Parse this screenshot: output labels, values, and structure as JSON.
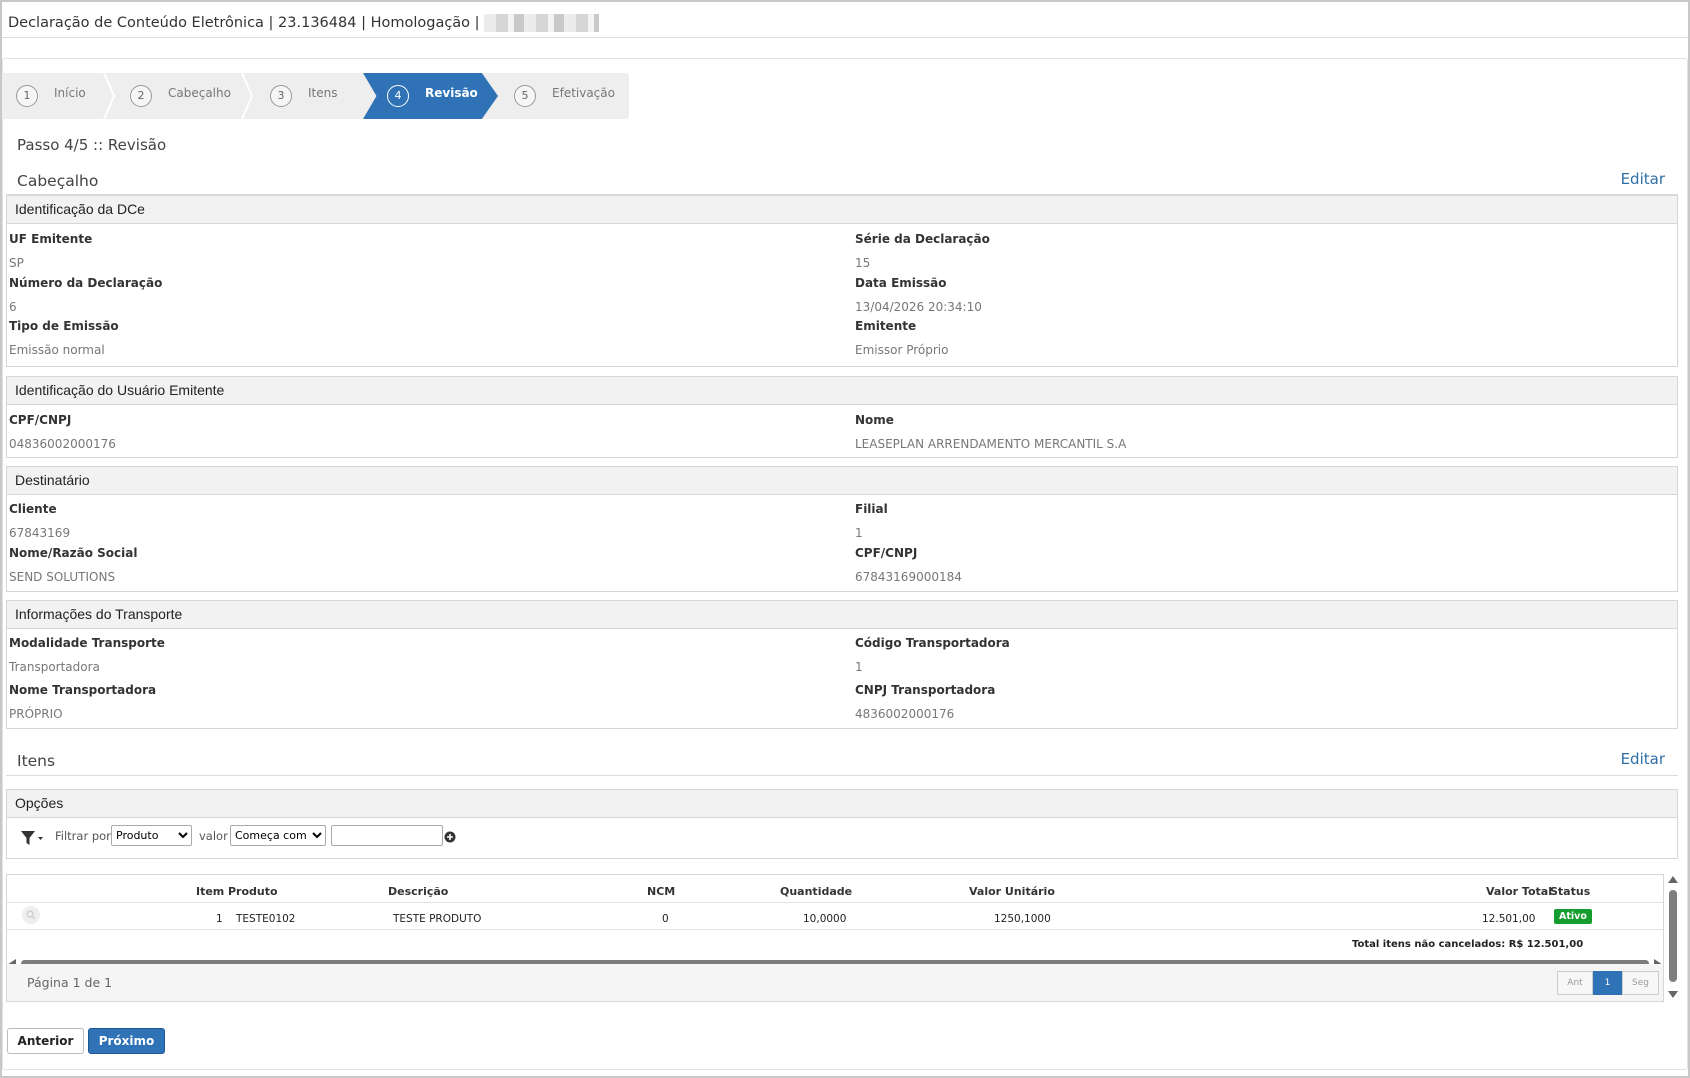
{
  "header": {
    "title": "Declaração de Conteúdo Eletrônica | 23.136484 | Homologação |"
  },
  "wizard": {
    "steps": [
      {
        "num": "1",
        "label": "Início"
      },
      {
        "num": "2",
        "label": "Cabeçalho"
      },
      {
        "num": "3",
        "label": "Itens"
      },
      {
        "num": "4",
        "label": "Revisão"
      },
      {
        "num": "5",
        "label": "Efetivação"
      }
    ]
  },
  "step_title": "Passo 4/5 :: Revisão",
  "cabecalho": {
    "title": "Cabeçalho",
    "edit_label": "Editar",
    "identificacao": {
      "title": "Identificação da DCe",
      "uf_label": "UF Emitente",
      "uf_value": "SP",
      "serie_label": "Série da Declaração",
      "serie_value": "15",
      "numero_label": "Número da Declaração",
      "numero_value": "6",
      "data_label": "Data Emissão",
      "data_value": "13/04/2026 20:34:10",
      "tipo_label": "Tipo de Emissão",
      "tipo_value": "Emissão normal",
      "emitente_label": "Emitente",
      "emitente_value": "Emissor Próprio"
    },
    "usuario": {
      "title": "Identificação do Usuário Emitente",
      "cpf_label": "CPF/CNPJ",
      "cpf_value": "04836002000176",
      "nome_label": "Nome",
      "nome_value": "LEASEPLAN ARRENDAMENTO MERCANTIL S.A"
    },
    "destinatario": {
      "title": "Destinatário",
      "cliente_label": "Cliente",
      "cliente_value": "67843169",
      "filial_label": "Filial",
      "filial_value": "1",
      "razao_label": "Nome/Razão Social",
      "razao_value": "SEND SOLUTIONS",
      "cpf_label": "CPF/CNPJ",
      "cpf_value": "67843169000184"
    },
    "transporte": {
      "title": "Informações do Transporte",
      "modalidade_label": "Modalidade Transporte",
      "modalidade_value": "Transportadora",
      "codigo_label": "Código Transportadora",
      "codigo_value": "1",
      "nome_label": "Nome Transportadora",
      "nome_value": "PRÓPRIO",
      "cnpj_label": "CNPJ Transportadora",
      "cnpj_value": "4836002000176"
    }
  },
  "itens": {
    "title": "Itens",
    "edit_label": "Editar",
    "opcoes_title": "Opções",
    "filter": {
      "filtrar_label": "Filtrar por",
      "field_selected": "Produto",
      "valor_label": "valor",
      "operator_selected": "Começa com",
      "value": ""
    },
    "columns": [
      "Item",
      "Produto",
      "Descrição",
      "NCM",
      "Quantidade",
      "Valor Unitário",
      "Valor Total",
      "Status"
    ],
    "rows": [
      {
        "item": "1",
        "produto": "TESTE0102",
        "descricao": "TESTE PRODUTO",
        "ncm": "0",
        "quantidade": "10,0000",
        "valor_unitario": "1250,1000",
        "valor_total": "12.501,00",
        "status": "Ativo"
      }
    ],
    "total_label": "Total itens não cancelados: R$ 12.501,00",
    "pager": {
      "info": "Página 1 de 1",
      "prev": "Ant",
      "current": "1",
      "next": "Seg"
    }
  },
  "buttons": {
    "previous": "Anterior",
    "next": "Próximo"
  },
  "colors": {
    "primary": "#2f73b6",
    "link": "#2f6fa7",
    "status_ok": "#169d2f"
  }
}
